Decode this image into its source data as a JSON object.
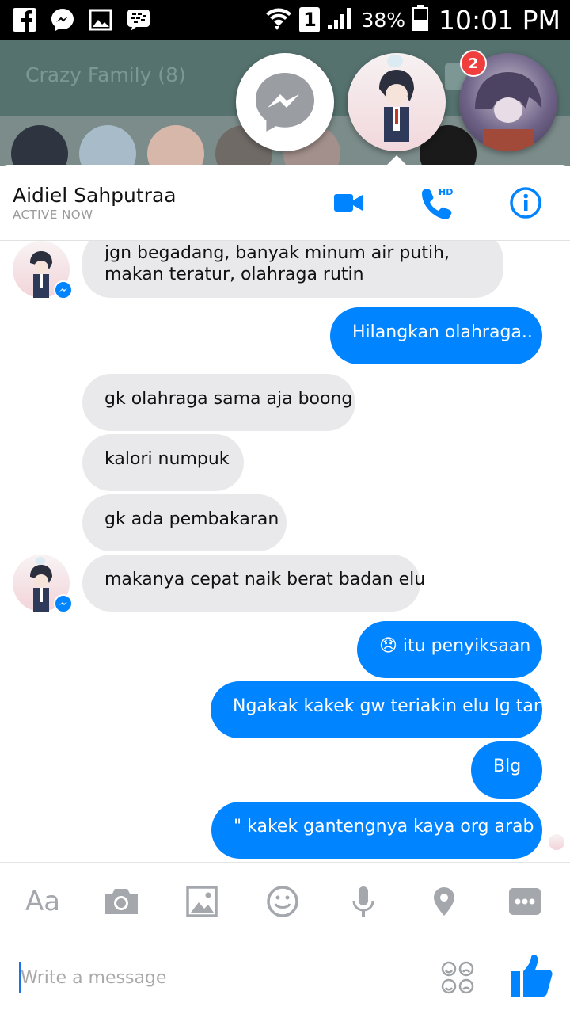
{
  "status_bar": {
    "battery": "38%",
    "time": "10:01 PM",
    "sim_label": "1"
  },
  "background_app": {
    "title": "Crazy Family (8)"
  },
  "chat_heads": {
    "badge_count": "2"
  },
  "chat": {
    "contact_name": "Aidiel Sahputraa",
    "contact_status": "ACTIVE NOW",
    "call_badge": "HD"
  },
  "messages": [
    {
      "dir": "in",
      "text": "jgn begadang, banyak minum air putih,\nmakan teratur, olahraga rutin"
    },
    {
      "dir": "out",
      "text": "Hilangkan olahraga.."
    },
    {
      "dir": "in",
      "text": "gk olahraga sama aja boong"
    },
    {
      "dir": "in",
      "text": "kalori numpuk"
    },
    {
      "dir": "in",
      "text": "gk ada pembakaran"
    },
    {
      "dir": "in",
      "text": "makanya cepat naik berat badan elu"
    },
    {
      "dir": "out",
      "text": "😞 itu penyiksaan"
    },
    {
      "dir": "out",
      "text": "Ngakak kakek gw teriakin elu lg tar"
    },
    {
      "dir": "out",
      "text": "Blg"
    },
    {
      "dir": "out",
      "text": "\" kakek gantengnya kaya org arab \""
    }
  ],
  "composer": {
    "text_tool_label": "Aa",
    "placeholder": "Write a message"
  },
  "icons": [
    "facebook-icon",
    "messenger-icon",
    "gallery-icon",
    "bbm-icon",
    "wifi-icon",
    "signal-icon",
    "battery-icon",
    "video-call-icon",
    "phone-icon",
    "info-icon",
    "camera-icon",
    "image-icon",
    "emoji-icon",
    "microphone-icon",
    "location-icon",
    "more-icon",
    "sticker-icon",
    "like-icon"
  ],
  "colors": {
    "accent": "#0084ff",
    "incoming_bubble": "#e9e9eb",
    "badge": "#f03d3d",
    "background_app": "#5f7f7b"
  }
}
